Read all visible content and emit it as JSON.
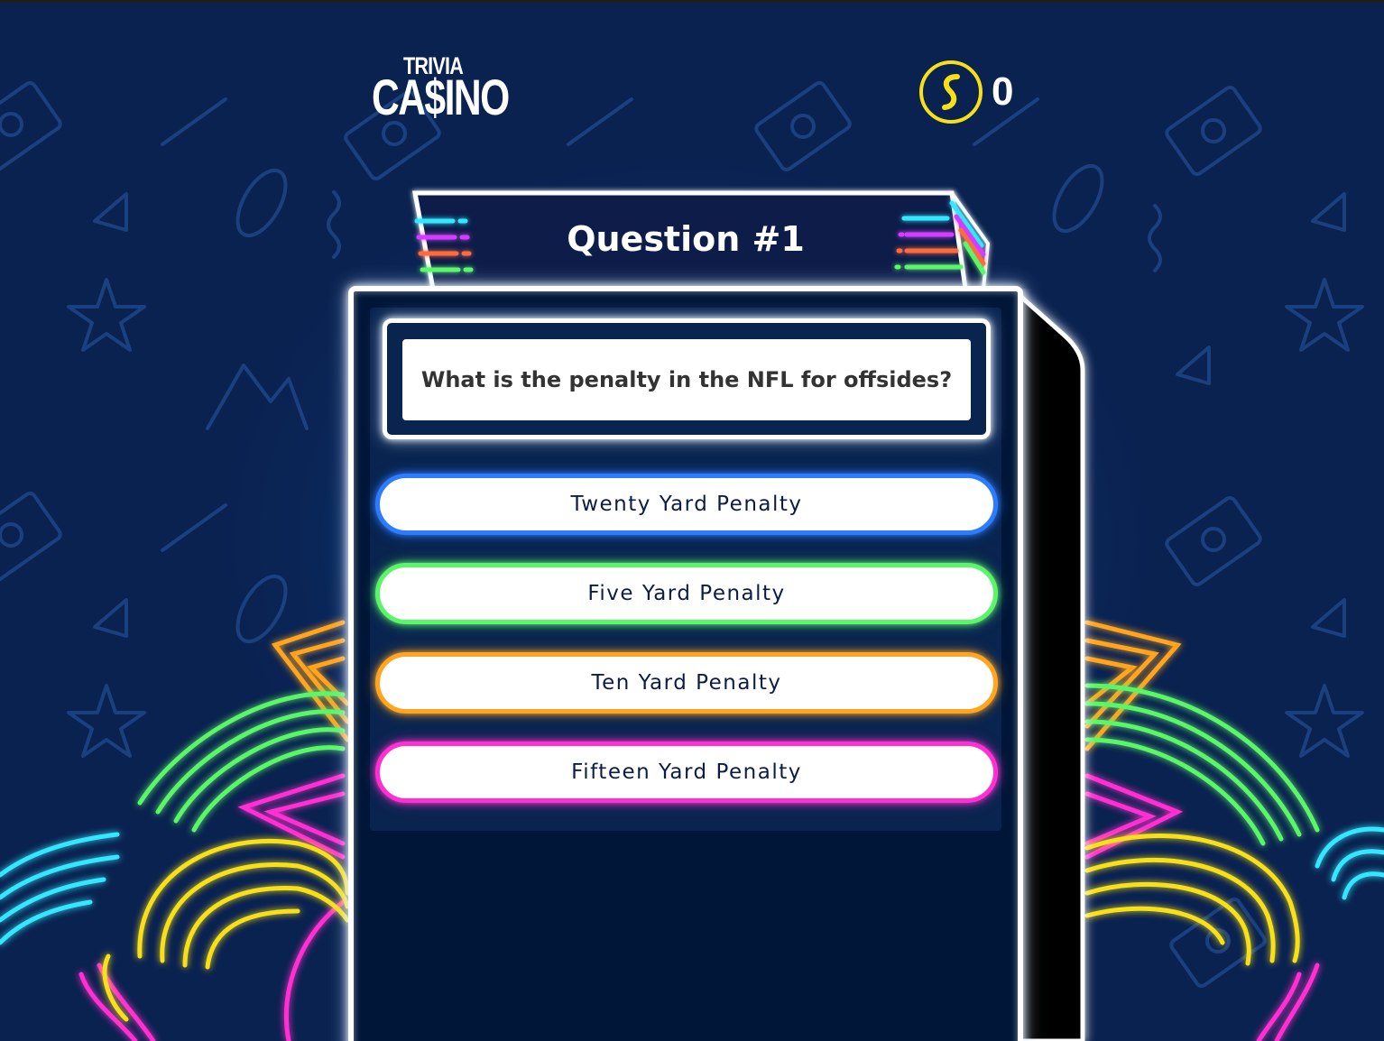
{
  "logo": {
    "line1": "TRIVIA",
    "line2": "CA$INO"
  },
  "coins": {
    "count": "0",
    "icon": "coin-icon"
  },
  "question": {
    "number_label": "Question #1",
    "text": "What is the penalty in the NFL for offsides?"
  },
  "answers": [
    {
      "label": "Twenty Yard Penalty",
      "color": "#2d7cff"
    },
    {
      "label": "Five Yard Penalty",
      "color": "#5cf56a"
    },
    {
      "label": "Ten Yard Penalty",
      "color": "#ffa51f"
    },
    {
      "label": "Fifteen Yard Penalty",
      "color": "#ff2fd1"
    }
  ],
  "colors": {
    "background": "#0a2557",
    "machine": "#001638",
    "neon_cyan": "#35e6ff",
    "neon_pink": "#ff2fd1",
    "neon_orange": "#ffa51f",
    "neon_yellow": "#f7e01a",
    "neon_green": "#5cf56a"
  }
}
